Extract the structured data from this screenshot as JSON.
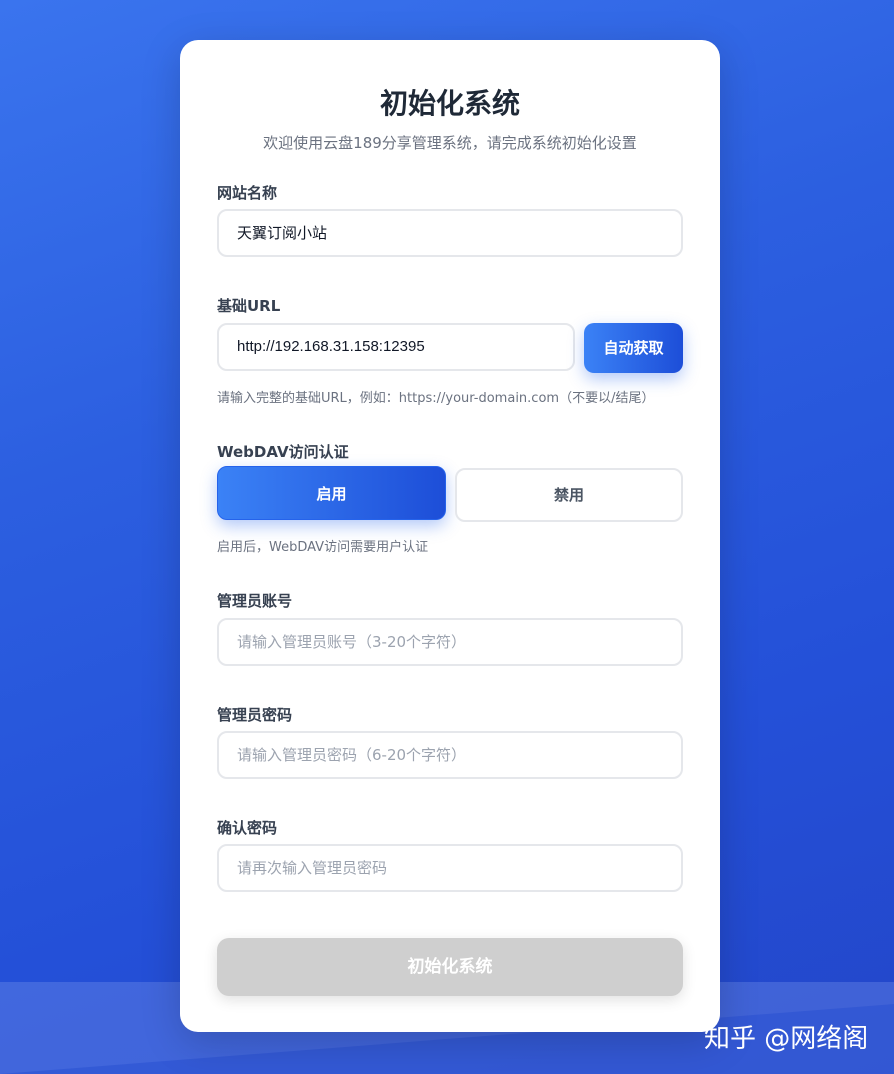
{
  "header": {
    "title": "初始化系统",
    "subtitle": "欢迎使用云盘189分享管理系统，请完成系统初始化设置"
  },
  "form": {
    "site_name": {
      "label": "网站名称",
      "value": "天翼订阅小站"
    },
    "base_url": {
      "label": "基础URL",
      "value": "http://192.168.31.158:12395",
      "auto_button": "自动获取",
      "hint": "请输入完整的基础URL，例如：https://your-domain.com（不要以/结尾）"
    },
    "webdav": {
      "label": "WebDAV访问认证",
      "enable": "启用",
      "disable": "禁用",
      "selected": "启用",
      "hint": "启用后，WebDAV访问需要用户认证"
    },
    "admin_account": {
      "label": "管理员账号",
      "placeholder": "请输入管理员账号（3-20个字符）"
    },
    "admin_password": {
      "label": "管理员密码",
      "placeholder": "请输入管理员密码（6-20个字符）"
    },
    "confirm_password": {
      "label": "确认密码",
      "placeholder": "请再次输入管理员密码"
    },
    "submit": "初始化系统"
  },
  "watermark": "知乎 @网络阁",
  "colors": {
    "accent": "#2563eb",
    "background": "#2c5fe0",
    "disabled": "#cfcfcf"
  }
}
